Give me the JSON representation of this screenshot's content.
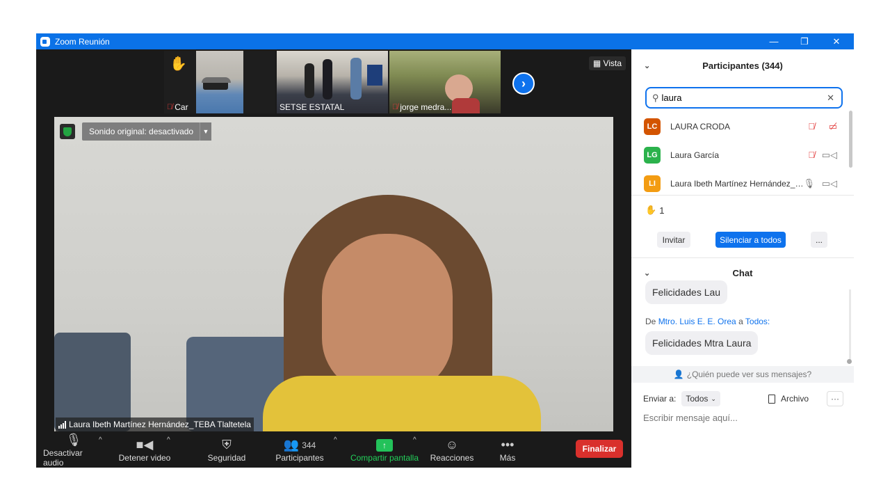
{
  "window": {
    "title": "Zoom Reunión",
    "minimize": "—",
    "maximize": "❐",
    "close": "✕"
  },
  "thumbnails": [
    {
      "name": "Car",
      "muted": true
    },
    {
      "name": "SETSE ESTATAL",
      "muted": false
    },
    {
      "name": "jorge medra...",
      "muted": true
    }
  ],
  "view_label": "Vista",
  "main_video": {
    "audio_banner": "Sonido original: desactivado",
    "speaker_name": "Laura Ibeth  Martínez Hernández_TEBA Tlaltetela"
  },
  "toolbar": {
    "audio": "Desactivar audio",
    "video": "Detener video",
    "security": "Seguridad",
    "participants": "Participantes",
    "participants_count": "344",
    "share": "Compartir pantalla",
    "reactions": "Reacciones",
    "more": "Más",
    "end": "Finalizar"
  },
  "participants_panel": {
    "title": "Participantes (344)",
    "search_value": "laura",
    "list": [
      {
        "initials": "LC",
        "name": "LAURA CRODA",
        "color": "#d35400"
      },
      {
        "initials": "LG",
        "name": "Laura García",
        "color": "#2bb24c"
      },
      {
        "initials": "LI",
        "name": "Laura Ibeth  Martínez Hernández_TEBA Tlaltetela",
        "color": "#f39c12"
      }
    ],
    "raised_hands": "1",
    "invite": "Invitar",
    "mute_all": "Silenciar a todos",
    "more": "..."
  },
  "chat": {
    "title": "Chat",
    "messages": [
      {
        "text": "Felicidades Lau"
      },
      {
        "from_prefix": "De",
        "sender": "Mtro. Luis E. E. Orea",
        "to_prefix": "a",
        "recipient": "Todos:",
        "text": "Felicidades Mtra Laura"
      }
    ],
    "who_can_see": "¿Quién puede ver sus mensajes?",
    "send_to_label": "Enviar a:",
    "send_to_value": "Todos",
    "file_label": "Archivo",
    "more": "···",
    "input_placeholder": "Escribir mensaje aquí..."
  }
}
